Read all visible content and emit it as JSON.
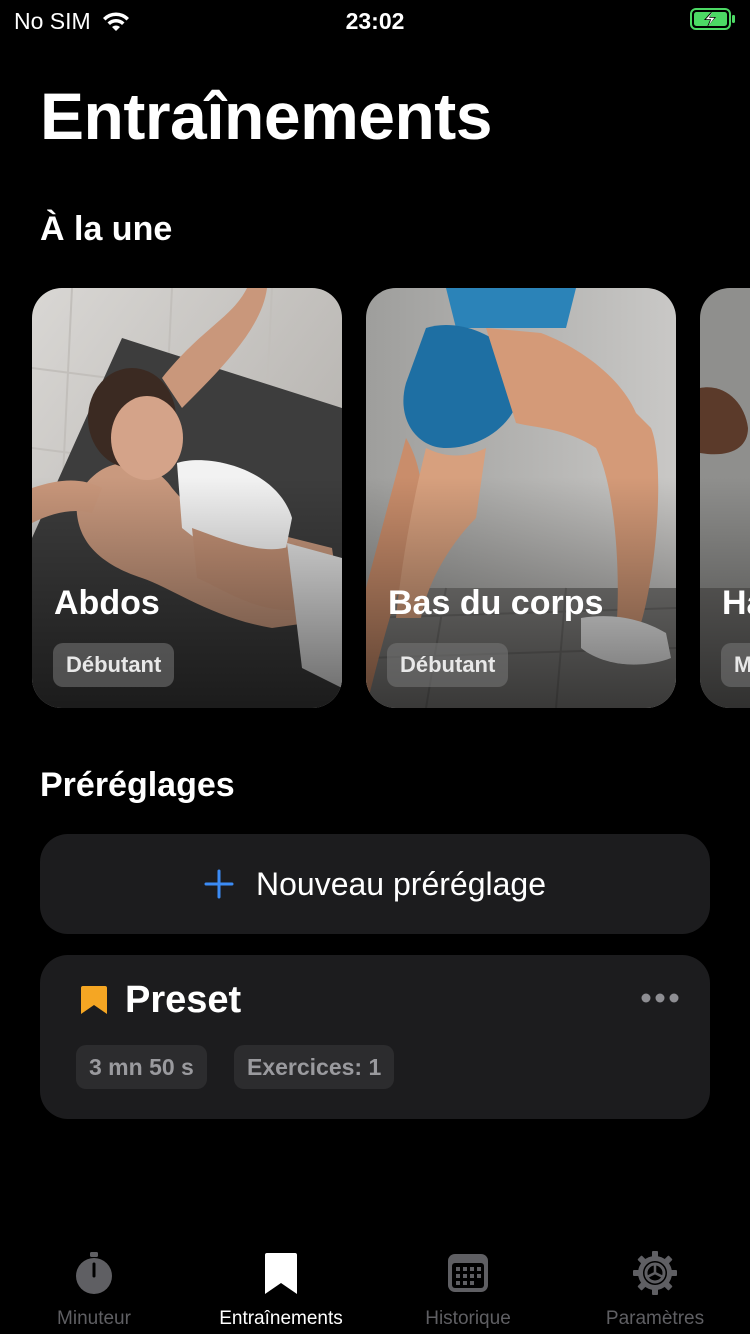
{
  "status_bar": {
    "carrier": "No SIM",
    "time": "23:02",
    "battery_color": "#4cd964"
  },
  "page": {
    "title": "Entraînements"
  },
  "featured": {
    "section_title": "À la une",
    "cards": [
      {
        "title": "Abdos",
        "level": "Débutant"
      },
      {
        "title": "Bas du corps",
        "level": "Débutant"
      },
      {
        "title": "Ha",
        "level": "M"
      }
    ]
  },
  "presets": {
    "section_title": "Préréglages",
    "new_preset_label": "Nouveau préréglage",
    "accent_color": "#3b8bf5",
    "items": [
      {
        "name": "Preset",
        "duration": "3 mn 50 s",
        "exercises": "Exercices: 1",
        "icon_color": "#f5a623"
      }
    ]
  },
  "tab_bar": {
    "tabs": [
      {
        "label": "Minuteur",
        "icon": "stopwatch-icon",
        "active": false
      },
      {
        "label": "Entraînements",
        "icon": "bookmark-icon",
        "active": true
      },
      {
        "label": "Historique",
        "icon": "calendar-icon",
        "active": false
      },
      {
        "label": "Paramètres",
        "icon": "gear-icon",
        "active": false
      }
    ]
  }
}
